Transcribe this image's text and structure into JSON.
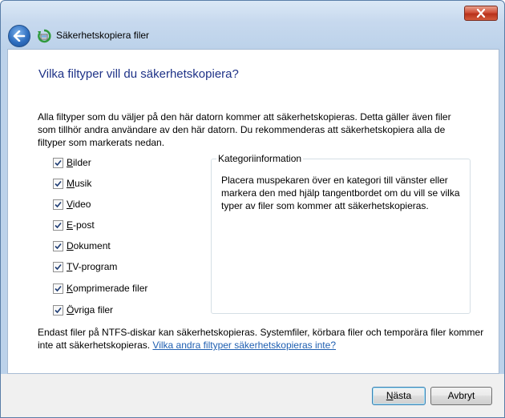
{
  "window": {
    "close_icon": "close-icon"
  },
  "nav": {
    "back_icon": "back-arrow-icon",
    "app_icon": "backup-icon",
    "title": "Säkerhetskopiera filer"
  },
  "page": {
    "heading": "Vilka filtyper vill du säkerhetskopiera?",
    "intro": "Alla filtyper som du väljer på den här datorn kommer att säkerhetskopieras. Detta gäller även filer som tillhör andra användare av den här datorn. Du rekommenderas att säkerhetskopiera alla de filtyper som markerats nedan."
  },
  "categories": [
    {
      "access": "B",
      "rest": "ilder",
      "checked": true
    },
    {
      "access": "M",
      "rest": "usik",
      "checked": true
    },
    {
      "access": "V",
      "rest": "ideo",
      "checked": true
    },
    {
      "access": "E",
      "rest": "-post",
      "checked": true
    },
    {
      "access": "D",
      "rest": "okument",
      "checked": true
    },
    {
      "access": "T",
      "rest": "V-program",
      "checked": true
    },
    {
      "access": "K",
      "rest": "omprimerade filer",
      "checked": true
    },
    {
      "access": "Ö",
      "rest": "vriga filer",
      "checked": true
    }
  ],
  "info": {
    "legend": "Kategoriinformation",
    "text": "Placera muspekaren över en kategori till vänster eller markera den med hjälp tangentbordet om du vill se vilka typer av filer som kommer att säkerhetskopieras."
  },
  "footnote": {
    "text": "Endast filer på NTFS-diskar kan säkerhetskopieras. Systemfiler, körbara filer och temporära filer kommer inte att säkerhetskopieras. ",
    "link": "Vilka andra filtyper säkerhetskopieras inte?"
  },
  "buttons": {
    "next_access": "N",
    "next_rest": "ästa",
    "cancel": "Avbryt"
  }
}
